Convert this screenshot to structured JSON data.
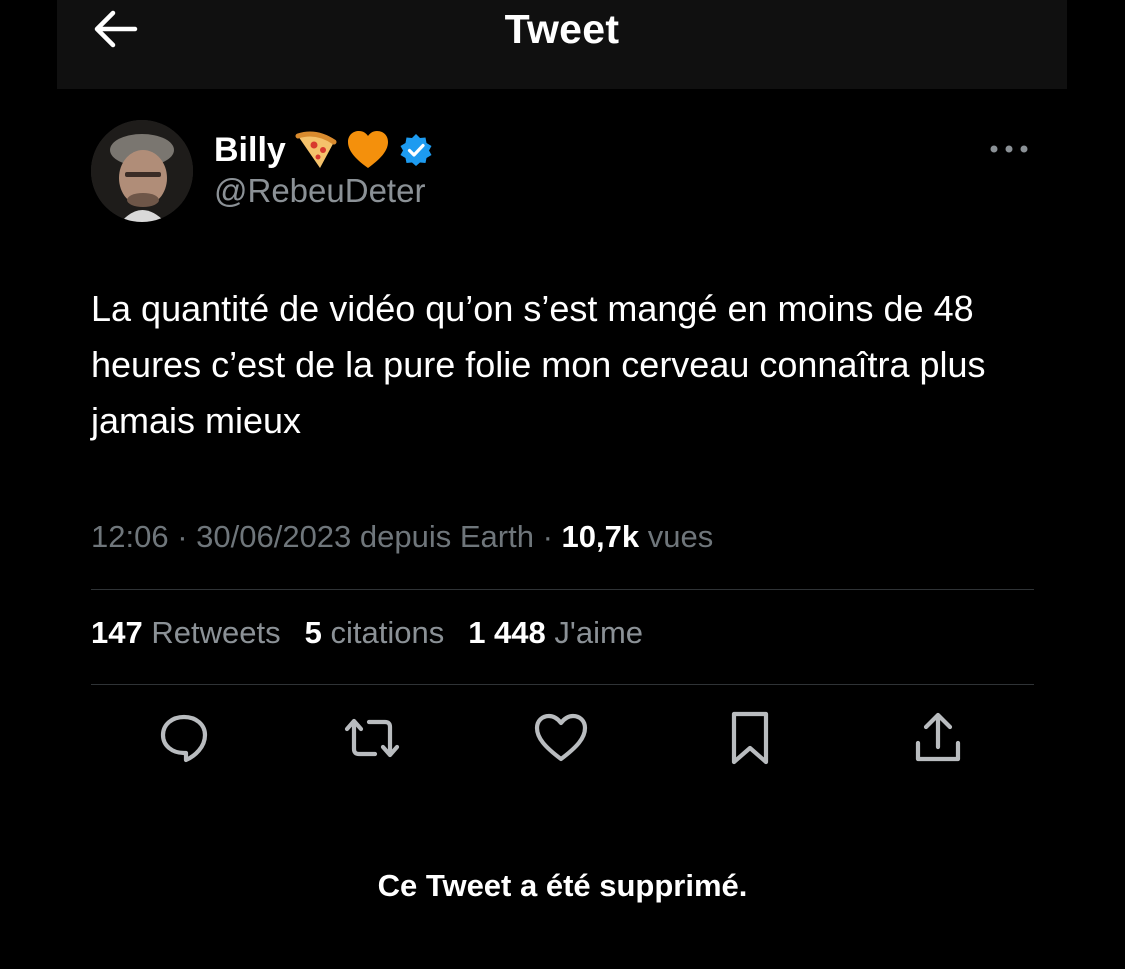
{
  "header": {
    "title": "Tweet"
  },
  "author": {
    "display_name": "Billy",
    "handle": "@RebeuDeter",
    "emojis": [
      "pizza-emoji",
      "orange-heart-emoji"
    ],
    "verified": true
  },
  "tweet": {
    "text": "La quantité de vidéo qu’on s’est mangé en moins de 48 heures c’est de la pure folie mon cerveau connaîtra plus jamais mieux",
    "time": "12:06",
    "date": "30/06/2023",
    "source": "depuis Earth",
    "views_count": "10,7k",
    "views_label": "vues"
  },
  "stats": {
    "retweets_count": "147",
    "retweets_label": "Retweets",
    "quotes_count": "5",
    "quotes_label": "citations",
    "likes_count": "1 448",
    "likes_label": "J'aime"
  },
  "actions": {
    "icons": [
      "reply-icon",
      "retweet-icon",
      "like-icon",
      "bookmark-icon",
      "share-icon"
    ]
  },
  "notice": "Ce Tweet a été supprimé.",
  "colors": {
    "background": "#000000",
    "header_bg": "#101010",
    "text_primary": "#ffffff",
    "text_secondary": "#8b9196",
    "verified_blue": "#1d9bf0",
    "heart_orange": "#f4900c",
    "divider": "#2f3336"
  }
}
